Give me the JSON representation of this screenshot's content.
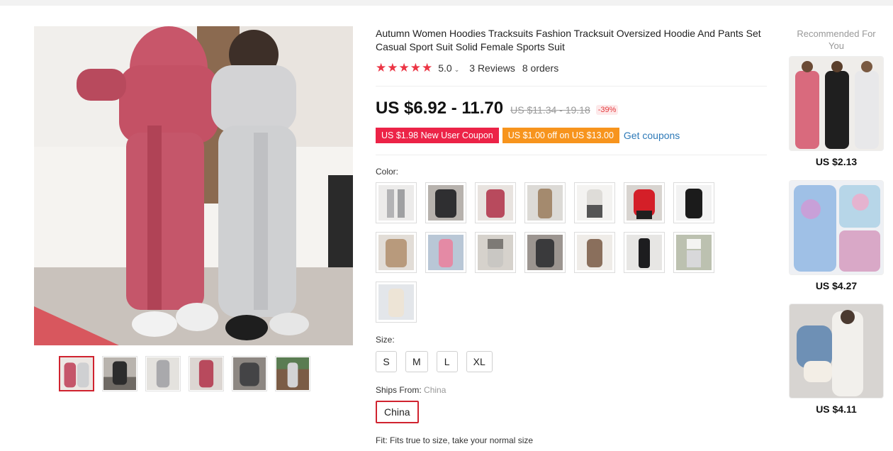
{
  "product": {
    "title": "Autumn Women Hoodies Tracksuits Fashion Tracksuit Oversized Hoodie And Pants Set Casual Sport Suit Solid Female Sports Suit",
    "rating": "5.0",
    "reviews": "3 Reviews",
    "orders": "8 orders",
    "price": "US $6.92 - 11.70",
    "original_price": "US $11.34 - 19.18",
    "discount": "-39%"
  },
  "coupons": {
    "new_user": "US $1.98 New User Coupon",
    "off": "US $1.00 off on US $13.00",
    "get_coupons": "Get coupons"
  },
  "color": {
    "label": "Color:",
    "options": [
      "light-gray",
      "charcoal",
      "rose-pink",
      "khaki",
      "white-gray",
      "red",
      "black",
      "camel",
      "pink",
      "gray-white",
      "dark-gray",
      "brown",
      "black-flare",
      "white-crop",
      "cream"
    ]
  },
  "size": {
    "label": "Size:",
    "options": [
      "S",
      "M",
      "L",
      "XL"
    ]
  },
  "ships_from": {
    "label": "Ships From:",
    "value": "China",
    "option": "China"
  },
  "fit": {
    "text": "Fit: Fits true to size, take your normal size"
  },
  "gallery": {
    "thumbnails": [
      "pink-gray-duo",
      "dark-set",
      "gray-set",
      "pink-set",
      "charcoal-set",
      "gray-outdoor"
    ]
  },
  "recommended": {
    "title": "Recommended For You",
    "items": [
      {
        "price": "US $2.13"
      },
      {
        "price": "US $4.27"
      },
      {
        "price": "US $4.11"
      }
    ]
  },
  "colors": {
    "star": "#ec3545",
    "coupon_red": "#ec2347",
    "coupon_orange": "#f7941d",
    "link_blue": "#2e7ab8",
    "selected_border": "#d0232f"
  }
}
